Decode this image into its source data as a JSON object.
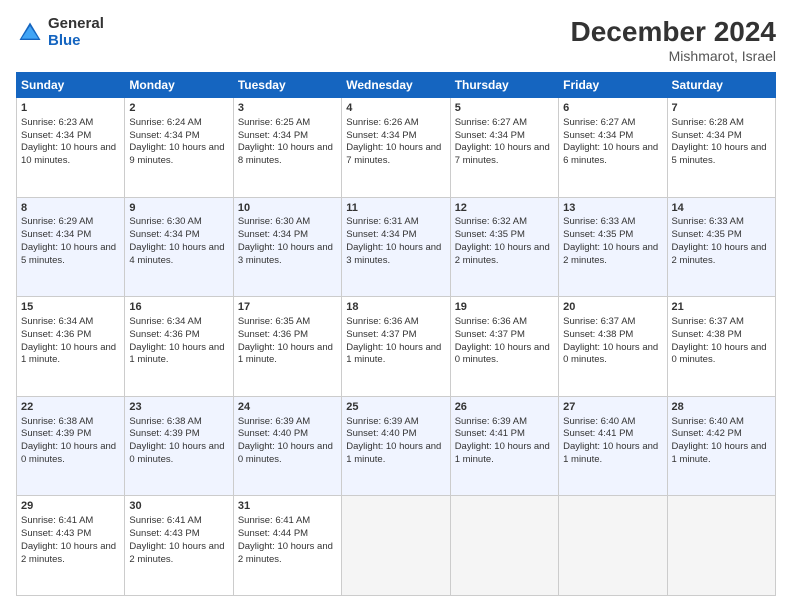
{
  "logo": {
    "general": "General",
    "blue": "Blue"
  },
  "header": {
    "month": "December 2024",
    "location": "Mishmarot, Israel"
  },
  "days": [
    "Sunday",
    "Monday",
    "Tuesday",
    "Wednesday",
    "Thursday",
    "Friday",
    "Saturday"
  ],
  "weeks": [
    [
      {
        "day": 1,
        "rise": "6:23 AM",
        "set": "4:34 PM",
        "daylight": "10 hours and 10 minutes."
      },
      {
        "day": 2,
        "rise": "6:24 AM",
        "set": "4:34 PM",
        "daylight": "10 hours and 9 minutes."
      },
      {
        "day": 3,
        "rise": "6:25 AM",
        "set": "4:34 PM",
        "daylight": "10 hours and 8 minutes."
      },
      {
        "day": 4,
        "rise": "6:26 AM",
        "set": "4:34 PM",
        "daylight": "10 hours and 7 minutes."
      },
      {
        "day": 5,
        "rise": "6:27 AM",
        "set": "4:34 PM",
        "daylight": "10 hours and 7 minutes."
      },
      {
        "day": 6,
        "rise": "6:27 AM",
        "set": "4:34 PM",
        "daylight": "10 hours and 6 minutes."
      },
      {
        "day": 7,
        "rise": "6:28 AM",
        "set": "4:34 PM",
        "daylight": "10 hours and 5 minutes."
      }
    ],
    [
      {
        "day": 8,
        "rise": "6:29 AM",
        "set": "4:34 PM",
        "daylight": "10 hours and 5 minutes."
      },
      {
        "day": 9,
        "rise": "6:30 AM",
        "set": "4:34 PM",
        "daylight": "10 hours and 4 minutes."
      },
      {
        "day": 10,
        "rise": "6:30 AM",
        "set": "4:34 PM",
        "daylight": "10 hours and 3 minutes."
      },
      {
        "day": 11,
        "rise": "6:31 AM",
        "set": "4:34 PM",
        "daylight": "10 hours and 3 minutes."
      },
      {
        "day": 12,
        "rise": "6:32 AM",
        "set": "4:35 PM",
        "daylight": "10 hours and 2 minutes."
      },
      {
        "day": 13,
        "rise": "6:33 AM",
        "set": "4:35 PM",
        "daylight": "10 hours and 2 minutes."
      },
      {
        "day": 14,
        "rise": "6:33 AM",
        "set": "4:35 PM",
        "daylight": "10 hours and 2 minutes."
      }
    ],
    [
      {
        "day": 15,
        "rise": "6:34 AM",
        "set": "4:36 PM",
        "daylight": "10 hours and 1 minute."
      },
      {
        "day": 16,
        "rise": "6:34 AM",
        "set": "4:36 PM",
        "daylight": "10 hours and 1 minute."
      },
      {
        "day": 17,
        "rise": "6:35 AM",
        "set": "4:36 PM",
        "daylight": "10 hours and 1 minute."
      },
      {
        "day": 18,
        "rise": "6:36 AM",
        "set": "4:37 PM",
        "daylight": "10 hours and 1 minute."
      },
      {
        "day": 19,
        "rise": "6:36 AM",
        "set": "4:37 PM",
        "daylight": "10 hours and 0 minutes."
      },
      {
        "day": 20,
        "rise": "6:37 AM",
        "set": "4:38 PM",
        "daylight": "10 hours and 0 minutes."
      },
      {
        "day": 21,
        "rise": "6:37 AM",
        "set": "4:38 PM",
        "daylight": "10 hours and 0 minutes."
      }
    ],
    [
      {
        "day": 22,
        "rise": "6:38 AM",
        "set": "4:39 PM",
        "daylight": "10 hours and 0 minutes."
      },
      {
        "day": 23,
        "rise": "6:38 AM",
        "set": "4:39 PM",
        "daylight": "10 hours and 0 minutes."
      },
      {
        "day": 24,
        "rise": "6:39 AM",
        "set": "4:40 PM",
        "daylight": "10 hours and 0 minutes."
      },
      {
        "day": 25,
        "rise": "6:39 AM",
        "set": "4:40 PM",
        "daylight": "10 hours and 1 minute."
      },
      {
        "day": 26,
        "rise": "6:39 AM",
        "set": "4:41 PM",
        "daylight": "10 hours and 1 minute."
      },
      {
        "day": 27,
        "rise": "6:40 AM",
        "set": "4:41 PM",
        "daylight": "10 hours and 1 minute."
      },
      {
        "day": 28,
        "rise": "6:40 AM",
        "set": "4:42 PM",
        "daylight": "10 hours and 1 minute."
      }
    ],
    [
      {
        "day": 29,
        "rise": "6:41 AM",
        "set": "4:43 PM",
        "daylight": "10 hours and 2 minutes."
      },
      {
        "day": 30,
        "rise": "6:41 AM",
        "set": "4:43 PM",
        "daylight": "10 hours and 2 minutes."
      },
      {
        "day": 31,
        "rise": "6:41 AM",
        "set": "4:44 PM",
        "daylight": "10 hours and 2 minutes."
      },
      null,
      null,
      null,
      null
    ]
  ]
}
